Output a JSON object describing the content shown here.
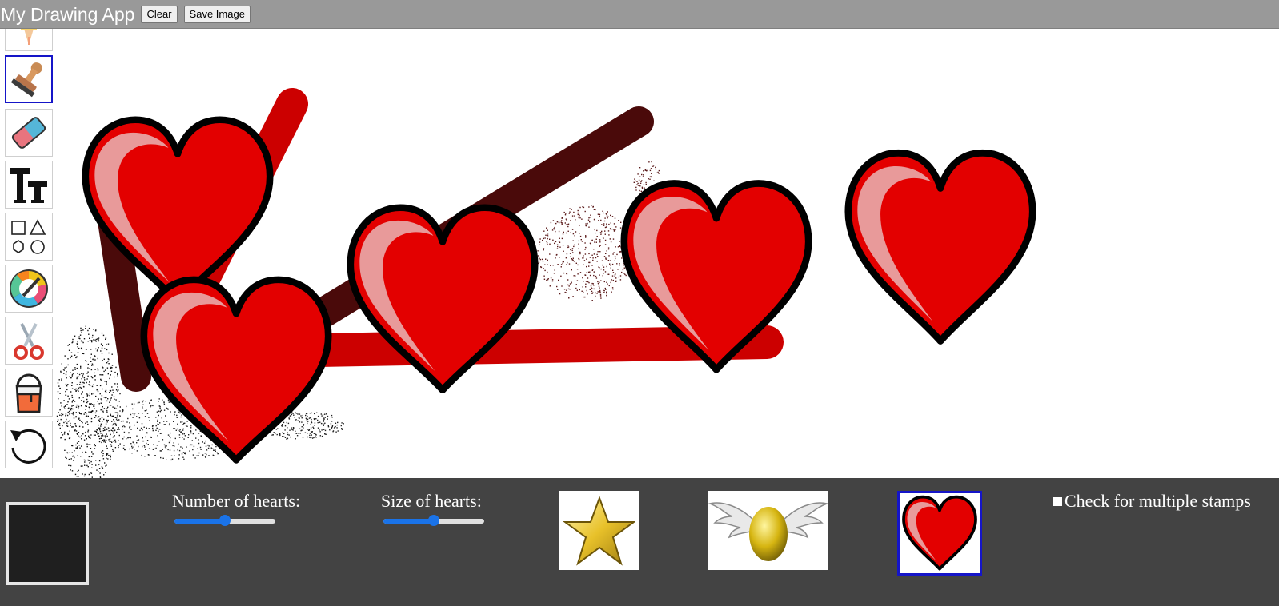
{
  "header": {
    "title": "My Drawing App",
    "clear_label": "Clear",
    "save_label": "Save Image"
  },
  "toolbar": {
    "tools": [
      {
        "name": "pencil",
        "icon": "pencil-icon"
      },
      {
        "name": "stamp",
        "icon": "stamp-icon",
        "selected": true
      },
      {
        "name": "eraser",
        "icon": "eraser-icon"
      },
      {
        "name": "text",
        "icon": "text-icon"
      },
      {
        "name": "shapes",
        "icon": "shapes-icon"
      },
      {
        "name": "color-picker",
        "icon": "color-wheel-icon"
      },
      {
        "name": "cut",
        "icon": "scissors-icon"
      },
      {
        "name": "fill",
        "icon": "paint-bucket-icon"
      },
      {
        "name": "undo",
        "icon": "undo-icon"
      }
    ]
  },
  "controls": {
    "current_color": "#1f1f1f",
    "number_label": "Number of hearts:",
    "number_value": 0.5,
    "size_label": "Size of hearts:",
    "size_value": 0.5,
    "stamps": [
      {
        "name": "star",
        "icon": "star-icon"
      },
      {
        "name": "winged-egg",
        "icon": "winged-egg-icon"
      },
      {
        "name": "heart",
        "icon": "heart-icon",
        "selected": true
      }
    ],
    "multiple_label": "Check for multiple stamps",
    "multiple_checked": false
  },
  "colors": {
    "header_bg": "#999999",
    "panel_bg": "#434343",
    "selected_border": "#1515c8",
    "slider_accent": "#1a73e8",
    "heart_red": "#e30000",
    "stroke_red": "#cc0000",
    "stroke_dark": "#4a0a0a"
  }
}
